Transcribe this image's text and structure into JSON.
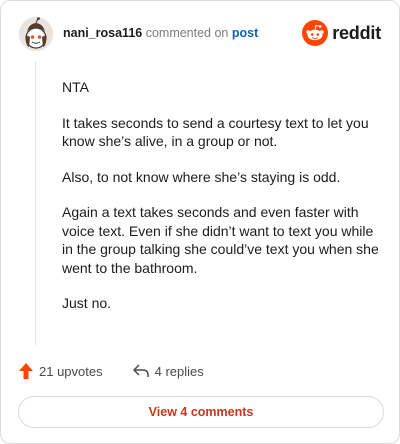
{
  "header": {
    "username": "nani_rosa116",
    "action_text": "commented on",
    "post_link": "post",
    "logo_text": "reddit"
  },
  "comment": {
    "paragraphs": [
      "NTA",
      "It takes seconds to send a courtesy text to let you know she’s alive, in a group or not.",
      "Also, to not know where she’s staying is odd.",
      "Again a text takes seconds and even faster with voice text. Even if she didn’t want to text you while in the group talking she could’ve text you when she went to the bathroom.",
      "Just no."
    ]
  },
  "actions": {
    "upvotes": "21 upvotes",
    "replies": "4 replies"
  },
  "footer": {
    "view_comments": "View 4 comments"
  },
  "colors": {
    "brand": "#ff4500",
    "upvote": "#ff4500",
    "link": "#0f62b8",
    "view_button_text": "#c8371d"
  },
  "icons": {
    "avatar": "snoo-avatar-icon",
    "logo": "reddit-snoo-icon",
    "upvote": "upvote-arrow-icon",
    "reply": "reply-arrow-icon"
  }
}
